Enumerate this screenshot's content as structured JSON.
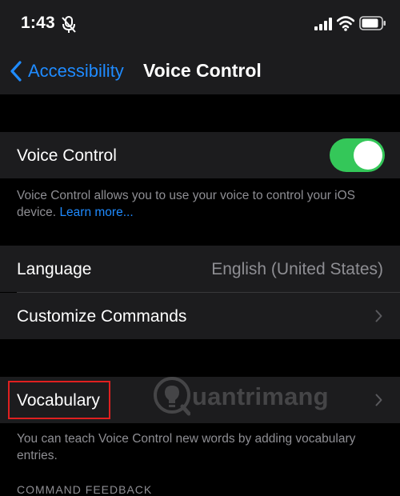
{
  "status_bar": {
    "time": "1:43",
    "icons": [
      "mute-icon",
      "signal-icon",
      "wifi-icon",
      "battery-icon"
    ]
  },
  "nav": {
    "back_label": "Accessibility",
    "title": "Voice Control"
  },
  "voice_control": {
    "label": "Voice Control",
    "toggle_on": true,
    "description": "Voice Control allows you to use your voice to control your iOS device.",
    "link_text": "Learn more..."
  },
  "language": {
    "label": "Language",
    "value": "English (United States)"
  },
  "customize": {
    "label": "Customize Commands"
  },
  "vocabulary": {
    "label": "Vocabulary",
    "description": "You can teach Voice Control new words by adding vocabulary entries."
  },
  "next_section_header": "COMMAND FEEDBACK",
  "watermark": {
    "text": "uantrimang"
  },
  "colors": {
    "background": "#000000",
    "cell": "#1c1c1e",
    "accent_blue": "#1f8bff",
    "toggle_green": "#34c759",
    "secondary_text": "#8e8e93",
    "highlight_red": "#e02020"
  }
}
